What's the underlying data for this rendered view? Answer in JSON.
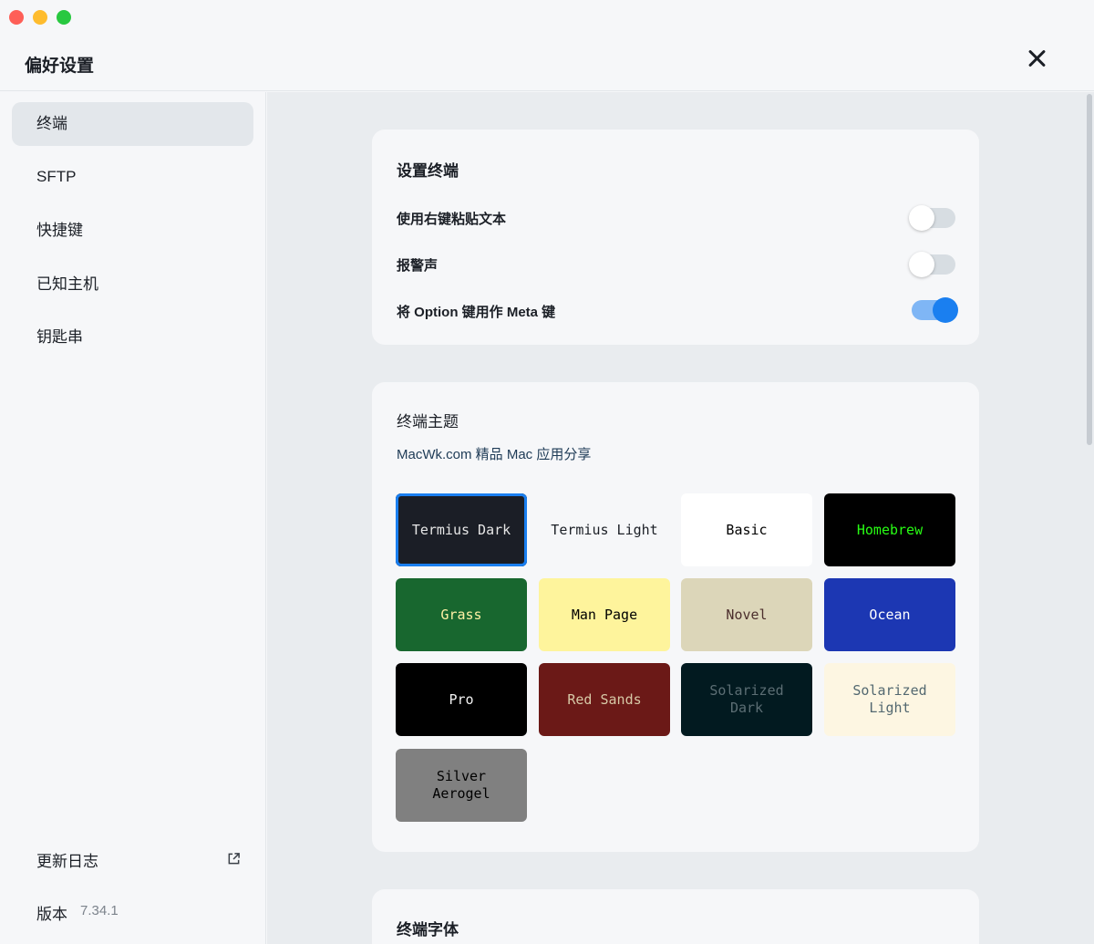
{
  "window": {
    "title": "偏好设置"
  },
  "sidebar": {
    "items": [
      {
        "label": "终端",
        "active": true
      },
      {
        "label": "SFTP",
        "active": false
      },
      {
        "label": "快捷键",
        "active": false
      },
      {
        "label": "已知主机",
        "active": false
      },
      {
        "label": "钥匙串",
        "active": false
      }
    ],
    "changelog_label": "更新日志",
    "version_label": "版本",
    "version_value": "7.34.1"
  },
  "terminal_settings": {
    "title": "设置终端",
    "options": [
      {
        "label": "使用右键粘贴文本",
        "enabled": false
      },
      {
        "label": "报警声",
        "enabled": false
      },
      {
        "label": "将 Option 键用作 Meta 键",
        "enabled": true
      }
    ]
  },
  "themes": {
    "title": "终端主题",
    "subtitle": "MacWk.com 精品 Mac 应用分享",
    "selected": "Termius Dark",
    "items": [
      {
        "label": "Termius Dark",
        "bg": "#1b1e26",
        "fg": "#e6e6e6"
      },
      {
        "label": "Termius Light",
        "bg": "#f6f7f9",
        "fg": "#1b1f26"
      },
      {
        "label": "Basic",
        "bg": "#ffffff",
        "fg": "#000000"
      },
      {
        "label": "Homebrew",
        "bg": "#000000",
        "fg": "#28fe14"
      },
      {
        "label": "Grass",
        "bg": "#18672f",
        "fg": "#fff0a5"
      },
      {
        "label": "Man Page",
        "bg": "#fef49c",
        "fg": "#000000"
      },
      {
        "label": "Novel",
        "bg": "#dcd6b9",
        "fg": "#4c2f2d"
      },
      {
        "label": "Ocean",
        "bg": "#1c37b3",
        "fg": "#ffffff"
      },
      {
        "label": "Pro",
        "bg": "#000000",
        "fg": "#f2f2f2"
      },
      {
        "label": "Red Sands",
        "bg": "#6b1917",
        "fg": "#d7c9a7"
      },
      {
        "label": "Solarized\nDark",
        "bg": "#021a20",
        "fg": "#5c6e74"
      },
      {
        "label": "Solarized\nLight",
        "bg": "#fdf6e2",
        "fg": "#536870"
      },
      {
        "label": "Silver\nAerogel",
        "bg": "#808080",
        "fg": "#000000"
      }
    ]
  },
  "font_section": {
    "title": "终端字体"
  },
  "colors": {
    "accent": "#1a7ff0"
  }
}
